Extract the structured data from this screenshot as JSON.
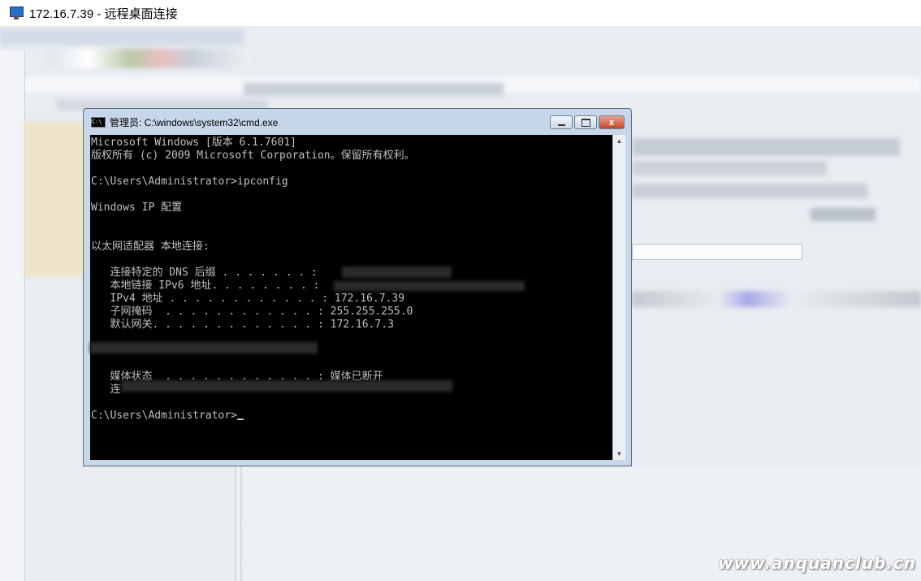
{
  "rdp_window": {
    "title": "172.16.7.39 - 远程桌面连接"
  },
  "cmd_window": {
    "title": "管理员: C:\\windows\\system32\\cmd.exe",
    "icon_label": "C:\\",
    "close_glyph": "x"
  },
  "console": {
    "lines": [
      "Microsoft Windows [版本 6.1.7601]",
      "版权所有 (c) 2009 Microsoft Corporation。保留所有权利。",
      "",
      "C:\\Users\\Administrator>ipconfig",
      "",
      "Windows IP 配置",
      "",
      "",
      "以太网适配器 本地连接:",
      "",
      "   连接特定的 DNS 后缀 . . . . . . . :",
      "   本地链接 IPv6 地址. . . . . . . . :",
      "   IPv4 地址 . . . . . . . . . . . . : 172.16.7.39",
      "   子网掩码  . . . . . . . . . . . . : 255.255.255.0",
      "   默认网关. . . . . . . . . . . . . : 172.16.7.3",
      "",
      "",
      "",
      "   媒体状态  . . . . . . . . . . . . : 媒体已断开",
      "   连",
      "",
      "C:\\Users\\Administrator>"
    ]
  },
  "watermark": "www.anquanclub.cn",
  "colors": {
    "console_bg": "#000000",
    "console_fg": "#c0c0c0",
    "cmd_frame": "#c7d6e8",
    "close_button": "#c7432a"
  }
}
